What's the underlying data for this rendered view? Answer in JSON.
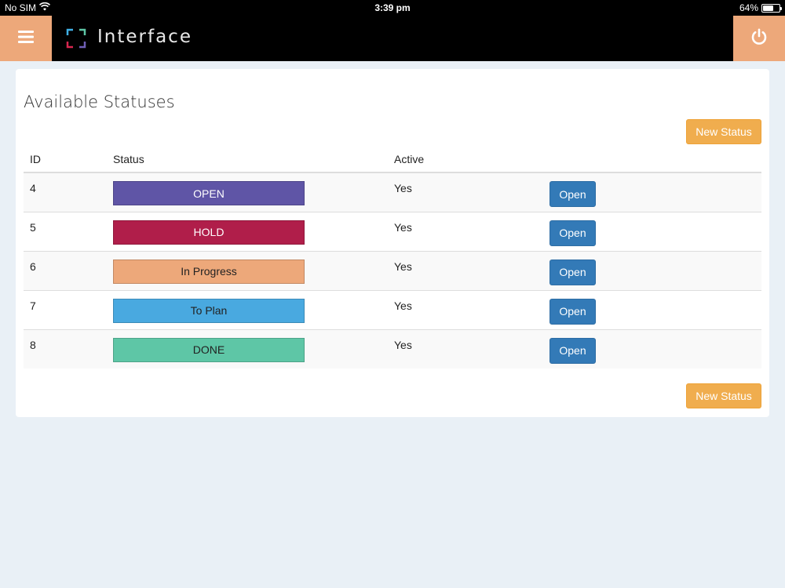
{
  "statusbar": {
    "carrier": "No SIM",
    "time": "3:39 pm",
    "battery": "64%",
    "battery_level": 0.64,
    "wifi_icon": "wifi-icon",
    "battery_icon": "battery-icon"
  },
  "header": {
    "app_title": "Interface",
    "menu_icon": "hamburger-menu-icon",
    "power_icon": "power-icon",
    "accent": "#eda87a"
  },
  "page": {
    "title": "Available Statuses",
    "new_status_label": "New Status"
  },
  "table": {
    "columns": {
      "id": "ID",
      "status": "Status",
      "active": "Active"
    },
    "rows": [
      {
        "id": "4",
        "status": "OPEN",
        "active": "Yes",
        "action": "Open",
        "color": "#5f55a6",
        "text_color": "#ffffff"
      },
      {
        "id": "5",
        "status": "HOLD",
        "active": "Yes",
        "action": "Open",
        "color": "#b01e4a",
        "text_color": "#ffffff"
      },
      {
        "id": "6",
        "status": "In Progress",
        "active": "Yes",
        "action": "Open",
        "color": "#eda87a",
        "text_color": "#222222"
      },
      {
        "id": "7",
        "status": "To Plan",
        "active": "Yes",
        "action": "Open",
        "color": "#49a9e0",
        "text_color": "#222222"
      },
      {
        "id": "8",
        "status": "DONE",
        "active": "Yes",
        "action": "Open",
        "color": "#5ec6a6",
        "text_color": "#222222"
      }
    ]
  },
  "colors": {
    "primary": "#337ab7",
    "warning": "#f0ad4e",
    "background": "#e9f0f6"
  }
}
